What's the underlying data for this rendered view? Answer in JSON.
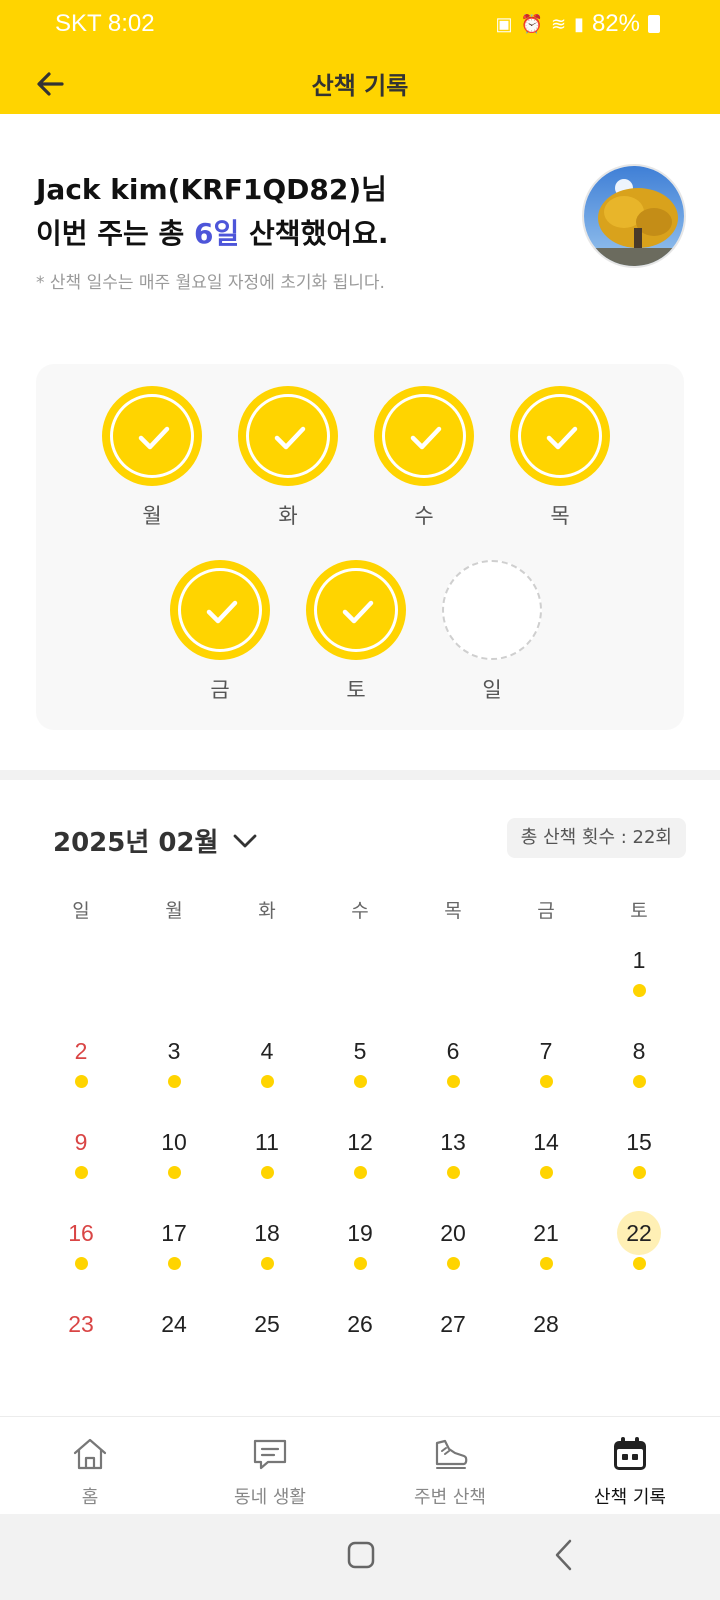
{
  "status_bar": {
    "carrier_time": "SKT 8:02",
    "battery": "82%",
    "icons": [
      "pay-icon",
      "alarm-icon",
      "wifi-icon",
      "signal-icon",
      "battery-icon"
    ]
  },
  "header": {
    "title": "산책 기록",
    "back_icon": "arrow-left-icon"
  },
  "summary": {
    "user": "Jack kim(KRF1QD82)님",
    "line2_prefix": "이번 주는 총 ",
    "count": "6일",
    "line2_suffix": " 산책했어요.",
    "note": "* 산책 일수는 매주 월요일 자정에 초기화 됩니다."
  },
  "week": [
    {
      "label": "월",
      "done": true
    },
    {
      "label": "화",
      "done": true
    },
    {
      "label": "수",
      "done": true
    },
    {
      "label": "목",
      "done": true
    },
    {
      "label": "금",
      "done": true
    },
    {
      "label": "토",
      "done": true
    },
    {
      "label": "일",
      "done": false
    }
  ],
  "calendar": {
    "month_label": "2025년 02월",
    "total_walks": "총 산책 횟수 : 22회",
    "weekdays": [
      "일",
      "월",
      "화",
      "수",
      "목",
      "금",
      "토"
    ],
    "days": [
      "1",
      "2",
      "3",
      "4",
      "5",
      "6",
      "7",
      "8",
      "9",
      "10",
      "11",
      "12",
      "13",
      "14",
      "15",
      "16",
      "17",
      "18",
      "19",
      "20",
      "21",
      "22",
      "23",
      "24",
      "25",
      "26",
      "27",
      "28"
    ],
    "walked_days": [
      "1",
      "2",
      "3",
      "4",
      "5",
      "6",
      "7",
      "8",
      "9",
      "10",
      "11",
      "12",
      "13",
      "14",
      "15",
      "16",
      "17",
      "18",
      "19",
      "20",
      "21",
      "22"
    ],
    "today": "22"
  },
  "bottom_nav": [
    {
      "label": "홈",
      "icon": "home-icon",
      "active": false
    },
    {
      "label": "동네 생활",
      "icon": "chat-icon",
      "active": false
    },
    {
      "label": "주변 산책",
      "icon": "shoe-icon",
      "active": false
    },
    {
      "label": "산책 기록",
      "icon": "calendar-icon",
      "active": true
    }
  ],
  "colors": {
    "brand": "#FFD400",
    "highlight": "#4D55D9",
    "sunday": "#D94545"
  }
}
